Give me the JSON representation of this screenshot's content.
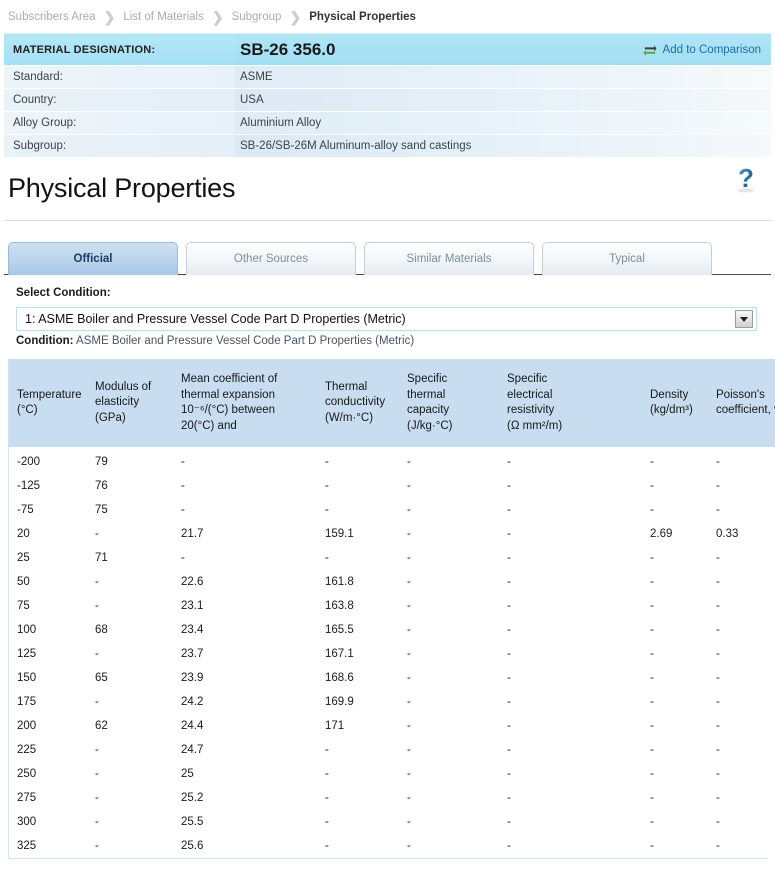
{
  "breadcrumb": {
    "items": [
      {
        "label": "Subscribers Area",
        "current": false
      },
      {
        "label": "List of Materials",
        "current": false
      },
      {
        "label": "Subgroup",
        "current": false
      },
      {
        "label": "Physical Properties",
        "current": true
      }
    ],
    "separator": "❯"
  },
  "material": {
    "designation_label": "MATERIAL DESIGNATION:",
    "designation_value": "SB-26 356.0",
    "add_to_comparison": "Add to Comparison",
    "rows": [
      {
        "label": "Standard:",
        "value": "ASME"
      },
      {
        "label": "Country:",
        "value": "USA"
      },
      {
        "label": "Alloy Group:",
        "value": "Aluminium Alloy"
      },
      {
        "label": "Subgroup:",
        "value": "SB-26/SB-26M Aluminum-alloy sand castings"
      }
    ]
  },
  "page": {
    "title": "Physical Properties",
    "help_label": "?"
  },
  "tabs": [
    {
      "label": "Official",
      "active": true
    },
    {
      "label": "Other Sources",
      "active": false
    },
    {
      "label": "Similar Materials",
      "active": false
    },
    {
      "label": "Typical",
      "active": false
    }
  ],
  "condition": {
    "select_label": "Select Condition:",
    "selected_option": "1: ASME Boiler and Pressure Vessel Code Part D Properties (Metric)",
    "options": [
      "1: ASME Boiler and Pressure Vessel Code Part D Properties (Metric)"
    ],
    "summary_prefix": "Condition:",
    "summary_value": "ASME Boiler and Pressure Vessel Code Part D Properties (Metric)"
  },
  "table": {
    "headers": [
      {
        "line1": "Temperature",
        "line2": "(°C)",
        "line3": "",
        "line4": ""
      },
      {
        "line1": "Modulus of",
        "line2": "elasticity",
        "line3": "(GPa)",
        "line4": ""
      },
      {
        "line1": "Mean coefficient of",
        "line2": "thermal expansion",
        "line3": "10⁻⁶/(°C) between",
        "line4": "20(°C) and"
      },
      {
        "line1": "Thermal",
        "line2": "conductivity",
        "line3": "(W/m·°C)",
        "line4": ""
      },
      {
        "line1": "Specific",
        "line2": "thermal",
        "line3": "capacity",
        "line4": "(J/kg·°C)"
      },
      {
        "line1": "Specific",
        "line2": "electrical",
        "line3": "resistivity",
        "line4": "(Ω mm²/m)"
      },
      {
        "line1": "Density",
        "line2": "(kg/dm³)",
        "line3": "",
        "line4": ""
      },
      {
        "line1": "Poisson's",
        "line2": "coefficient, v",
        "line3": "",
        "line4": ""
      }
    ],
    "rows": [
      [
        "-200",
        "79",
        "-",
        "-",
        "-",
        "-",
        "-",
        "-"
      ],
      [
        "-125",
        "76",
        "-",
        "-",
        "-",
        "-",
        "-",
        "-"
      ],
      [
        "-75",
        "75",
        "-",
        "-",
        "-",
        "-",
        "-",
        "-"
      ],
      [
        "20",
        "-",
        "21.7",
        "159.1",
        "-",
        "-",
        "2.69",
        "0.33"
      ],
      [
        "25",
        "71",
        "-",
        "-",
        "-",
        "-",
        "-",
        "-"
      ],
      [
        "50",
        "-",
        "22.6",
        "161.8",
        "-",
        "-",
        "-",
        "-"
      ],
      [
        "75",
        "-",
        "23.1",
        "163.8",
        "-",
        "-",
        "-",
        "-"
      ],
      [
        "100",
        "68",
        "23.4",
        "165.5",
        "-",
        "-",
        "-",
        "-"
      ],
      [
        "125",
        "-",
        "23.7",
        "167.1",
        "-",
        "-",
        "-",
        "-"
      ],
      [
        "150",
        "65",
        "23.9",
        "168.6",
        "-",
        "-",
        "-",
        "-"
      ],
      [
        "175",
        "-",
        "24.2",
        "169.9",
        "-",
        "-",
        "-",
        "-"
      ],
      [
        "200",
        "62",
        "24.4",
        "171",
        "-",
        "-",
        "-",
        "-"
      ],
      [
        "225",
        "-",
        "24.7",
        "-",
        "-",
        "-",
        "-",
        "-"
      ],
      [
        "250",
        "-",
        "25",
        "-",
        "-",
        "-",
        "-",
        "-"
      ],
      [
        "275",
        "-",
        "25.2",
        "-",
        "-",
        "-",
        "-",
        "-"
      ],
      [
        "300",
        "-",
        "25.5",
        "-",
        "-",
        "-",
        "-",
        "-"
      ],
      [
        "325",
        "-",
        "25.6",
        "-",
        "-",
        "-",
        "-",
        "-"
      ]
    ]
  },
  "colors": {
    "header_cyan": "#a9e2f5",
    "table_header_blue": "#c8de f0",
    "link_blue": "#1d6fa5",
    "active_tab_blue": "#bcd5ec",
    "swap_icon_green": "#4f9b2f"
  }
}
